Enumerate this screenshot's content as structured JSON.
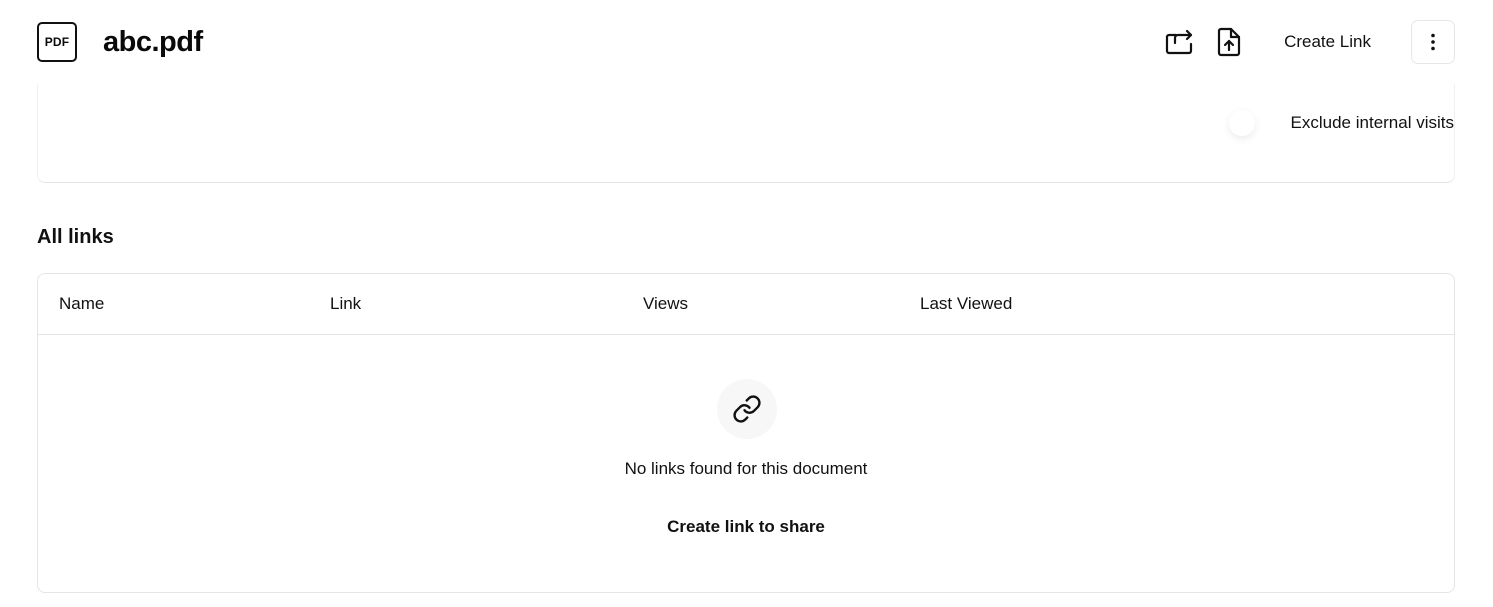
{
  "header": {
    "file_type_label": "PDF",
    "document_title": "abc.pdf",
    "create_link_label": "Create Link"
  },
  "stats": {
    "exclude_internal_label": "Exclude internal visits",
    "exclude_internal_enabled": false
  },
  "links_section": {
    "title": "All links",
    "columns": [
      "Name",
      "Link",
      "Views",
      "Last Viewed"
    ],
    "rows": [],
    "empty_message": "No links found for this document",
    "empty_cta": "Create link to share"
  },
  "icons": {
    "swap": "arrow-swap-icon",
    "upload": "file-upload-icon",
    "more": "more-vertical-icon",
    "link": "link-icon"
  }
}
